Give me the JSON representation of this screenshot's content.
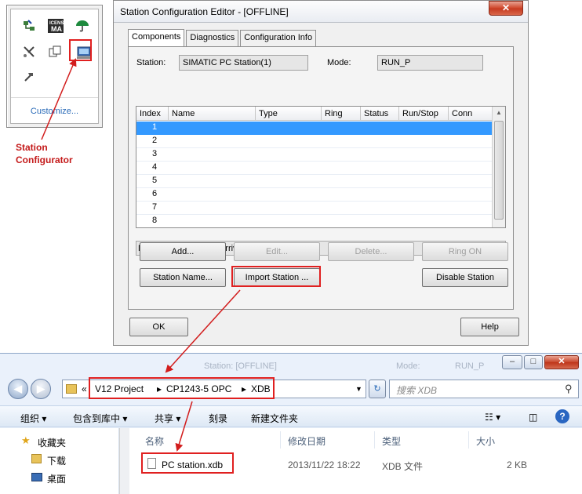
{
  "tray": {
    "icons": [
      "license-icon",
      "umbrella-icon",
      "network-icon",
      "copy-icon",
      "station-configurator-icon",
      "tool-icon"
    ],
    "license_text": "ICENSE MA",
    "customize": "Customize..."
  },
  "callout": {
    "line1": "Station",
    "line2": "Configurator"
  },
  "editor": {
    "title": "Station Configuration Editor - [OFFLINE]",
    "close_glyph": "✕",
    "tabs": [
      "Components",
      "Diagnostics",
      "Configuration Info"
    ],
    "station_label": "Station:",
    "station_value": "SIMATIC PC Station(1)",
    "mode_label": "Mode:",
    "mode_value": "RUN_P",
    "columns": [
      "Index",
      "Name",
      "Type",
      "Ring",
      "Status",
      "Run/Stop",
      "Conn"
    ],
    "rows": [
      "1",
      "2",
      "3",
      "4",
      "5",
      "6",
      "7",
      "8"
    ],
    "diagnostic": "New diagnostic entry arrived!",
    "buttons": {
      "add": "Add...",
      "edit": "Edit...",
      "delete": "Delete...",
      "ring_on": "Ring ON",
      "station_name": "Station Name...",
      "import_station": "Import Station ...",
      "disable_station": "Disable Station",
      "ok": "OK",
      "help": "Help"
    }
  },
  "explorer": {
    "ghost_station": "Station: [OFFLINE]",
    "ghost_mode": "Mode:",
    "ghost_run": "RUN_P",
    "win_min": "–",
    "win_max": "□",
    "win_close": "✕",
    "back": "◀",
    "forward": "▶",
    "breadcrumb_prefix": "«",
    "breadcrumb": [
      "V12 Project",
      "CP1243-5 OPC",
      "XDB"
    ],
    "search_placeholder": "搜索 XDB",
    "toolbar": [
      "组织 ▾",
      "包含到库中 ▾",
      "共享 ▾",
      "刻录",
      "新建文件夹"
    ],
    "nav_items": [
      "收藏夹",
      "下载",
      "桌面"
    ],
    "columns": [
      "名称",
      "修改日期",
      "类型",
      "大小"
    ],
    "file": {
      "name": "PC station.xdb",
      "modified": "2013/11/22 18:22",
      "type": "XDB 文件",
      "size": "2 KB"
    }
  },
  "colors": {
    "highlight": "#e02020",
    "callout": "#c41a1a",
    "selection": "#3399ff"
  }
}
